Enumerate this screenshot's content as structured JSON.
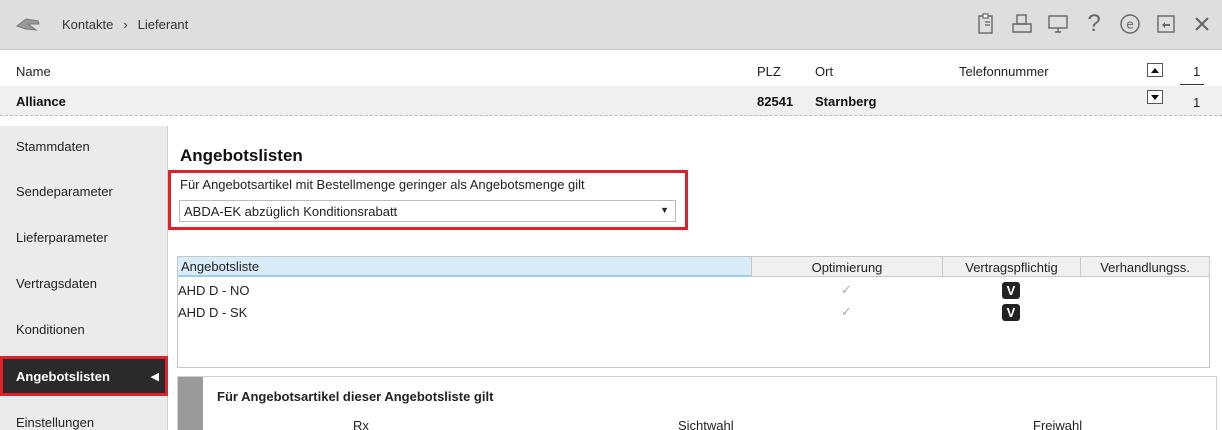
{
  "titlebar": {
    "breadcrumb": [
      "Kontakte",
      "Lieferant"
    ],
    "separator": "›",
    "icons": [
      "clipboard-icon",
      "print-icon",
      "monitor-icon",
      "help-icon",
      "ecircle-icon",
      "window-icon",
      "close-icon"
    ]
  },
  "header": {
    "labels": {
      "name": "Name",
      "plz": "PLZ",
      "ort": "Ort",
      "telefon": "Telefonnummer"
    },
    "values": {
      "name": "Alliance",
      "plz": "82541",
      "ort": "Starnberg",
      "telefon": ""
    },
    "pager": {
      "top": "1",
      "bottom": "1"
    }
  },
  "sidebar": {
    "items": [
      {
        "label": "Stammdaten"
      },
      {
        "label": "Sendeparameter"
      },
      {
        "label": "Lieferparameter"
      },
      {
        "label": "Vertragsdaten"
      },
      {
        "label": "Konditionen"
      },
      {
        "label": "Angebotslisten"
      },
      {
        "label": "Einstellungen"
      }
    ],
    "active_index": 5
  },
  "main": {
    "title": "Angebotslisten",
    "rule_label": "Für Angebotsartikel mit Bestellmenge geringer als Angebotsmenge gilt",
    "rule_value": "ABDA-EK abzüglich Konditionsrabatt",
    "table": {
      "columns": [
        "Angebotsliste",
        "Optimierung",
        "Vertragspflichtig",
        "Verhandlungss."
      ],
      "rows": [
        {
          "name": "AHD D - NO",
          "optimierung": "✓",
          "vertragspflichtig": "V"
        },
        {
          "name": "AHD D - SK",
          "optimierung": "✓",
          "vertragspflichtig": "V"
        }
      ]
    },
    "subpanel": {
      "title": "Für Angebotsartikel dieser Angebotsliste gilt",
      "columns": [
        "Rx",
        "Sichtwahl",
        "Freiwahl"
      ]
    }
  },
  "colors": {
    "highlight_red": "#e0202a",
    "active_bg": "#2a2a2a"
  }
}
